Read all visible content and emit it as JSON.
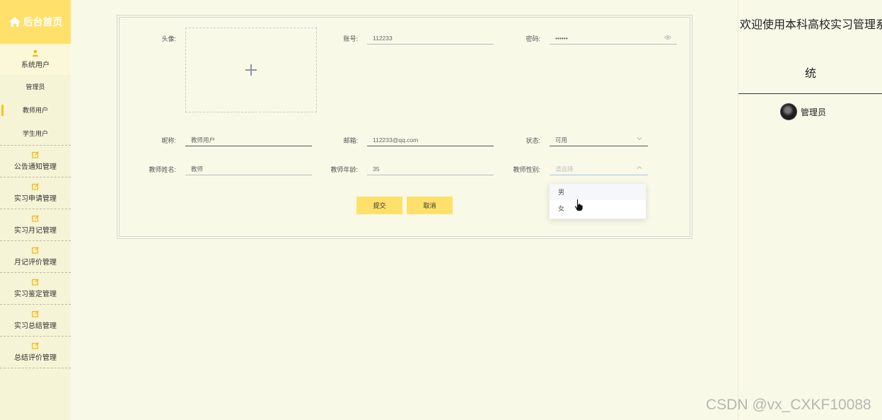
{
  "sidebar": {
    "brand": "后台首页",
    "user_menu": "系统用户",
    "sub_items": [
      "管理员",
      "教师用户",
      "学生用户"
    ],
    "menus": [
      "公告通知管理",
      "实习申请管理",
      "实习月记管理",
      "月记评价管理",
      "实习鉴定管理",
      "实习总结管理",
      "总结评价管理"
    ]
  },
  "form": {
    "avatar_label": "头像:",
    "account_label": "账号:",
    "account_value": "112233",
    "password_label": "密码:",
    "password_value": "••••••",
    "nickname_label": "昵称:",
    "nickname_value": "教师用户",
    "email_label": "邮箱:",
    "email_value": "112233@qq.com",
    "status_label": "状态:",
    "status_value": "可用",
    "teacher_name_label": "教师姓名:",
    "teacher_name_value": "教师",
    "teacher_age_label": "教师年龄:",
    "teacher_age_value": "35",
    "teacher_gender_label": "教师性别:",
    "teacher_gender_placeholder": "请选择",
    "gender_options": [
      "男",
      "女"
    ],
    "submit_label": "提交",
    "cancel_label": "取消"
  },
  "right_panel": {
    "welcome_line1": "欢迎使用本科高校实习管理系",
    "welcome_line2": "统",
    "username": "管理员"
  },
  "watermark": "CSDN @vx_CXKF10088",
  "colors": {
    "accent": "#ffe06a",
    "background": "#f9f9e8",
    "sidebar": "#f6f4d6"
  }
}
